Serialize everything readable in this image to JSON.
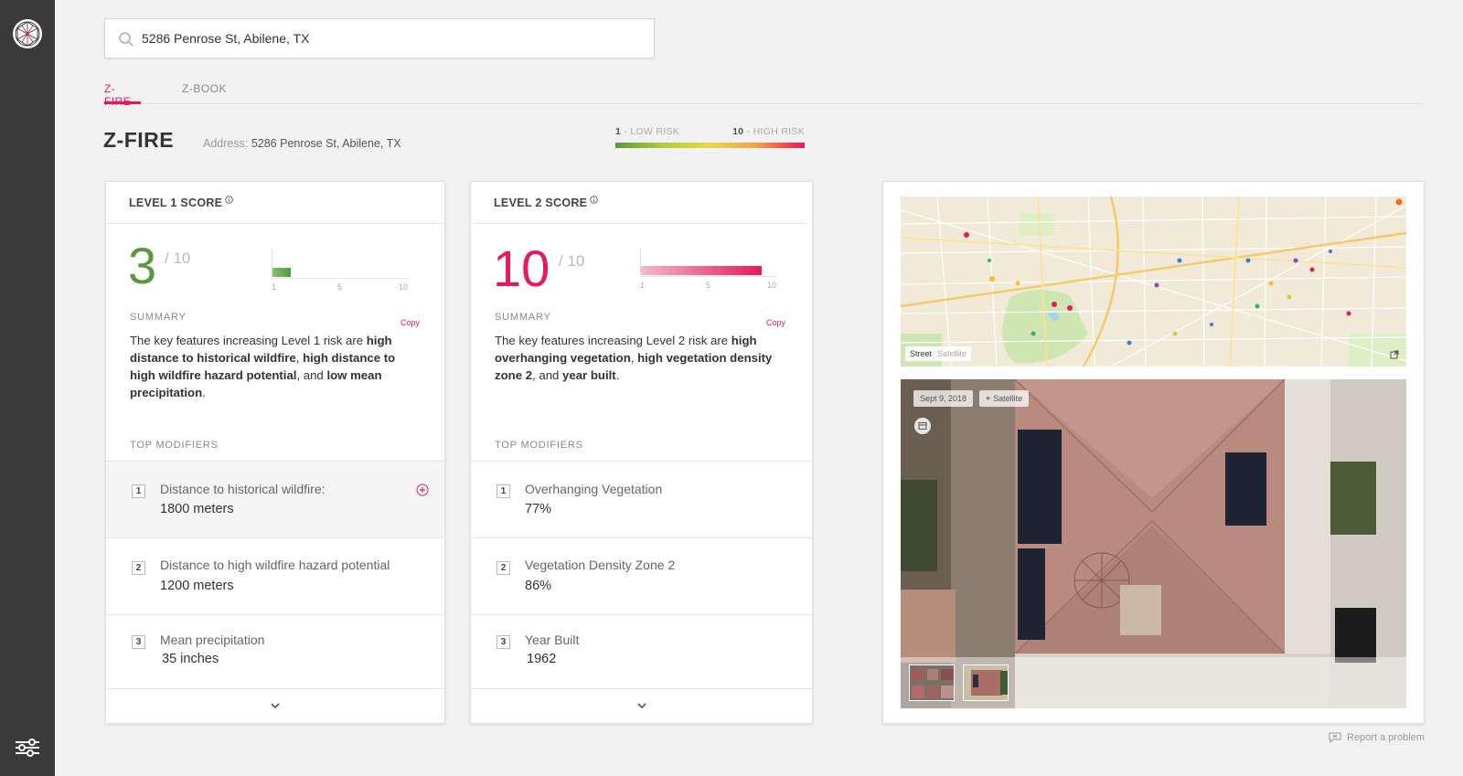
{
  "search": {
    "value": "5286 Penrose St, Abilene, TX"
  },
  "tabs": [
    {
      "label": "Z-FIRE",
      "active": true
    },
    {
      "label": "Z-BOOK",
      "active": false
    }
  ],
  "page": {
    "title": "Z-FIRE",
    "address_label": "Address:",
    "address_value": "5286 Penrose St, Abilene, TX"
  },
  "legend": {
    "low_num": "1",
    "low_text": "- LOW RISK",
    "high_num": "10",
    "high_text": "- HIGH RISK"
  },
  "level1": {
    "title": "LEVEL 1 SCORE",
    "score": "3",
    "score_fraction": 0.3,
    "max": "/ 10",
    "ticks": [
      "1",
      "5",
      "10"
    ],
    "summary_label": "SUMMARY",
    "copy_label": "Copy",
    "summary_parts": [
      "The key features increasing Level 1 risk are ",
      "high distance to historical wildfire",
      ", ",
      "high distance to high wildfire hazard potential",
      ", and ",
      "low mean precipitation",
      "."
    ],
    "modifiers_label": "TOP MODIFIERS",
    "modifiers": [
      {
        "num": "1",
        "label": "Distance to historical wildfire:",
        "value": "1800 meters"
      },
      {
        "num": "2",
        "label": "Distance to high wildfire hazard potential",
        "value": "1200 meters"
      },
      {
        "num": "3",
        "label": "Mean precipitation",
        "value": "35 inches"
      }
    ]
  },
  "level2": {
    "title": "LEVEL 2 SCORE",
    "score": "10",
    "score_fraction": 1.0,
    "max": "/ 10",
    "ticks": [
      "1",
      "5",
      "10"
    ],
    "summary_label": "SUMMARY",
    "copy_label": "Copy",
    "summary_parts": [
      "The key features increasing Level 2 risk are ",
      "high overhanging vegetation",
      ", ",
      "high vegetation density zone 2",
      ", and ",
      "year built",
      "."
    ],
    "modifiers_label": "TOP MODIFIERS",
    "modifiers": [
      {
        "num": "1",
        "label": "Overhanging Vegetation",
        "value": "77%"
      },
      {
        "num": "2",
        "label": "Vegetation Density Zone 2",
        "value": "86%"
      },
      {
        "num": "3",
        "label": "Year Built",
        "value": "1962"
      }
    ]
  },
  "map": {
    "street_label": "Street",
    "satellite_label": "Satellite"
  },
  "aerial": {
    "date": "Sept 9, 2018",
    "source": "Satellite"
  },
  "report": {
    "label": "Report a problem"
  },
  "colors": {
    "accent": "#e8195a",
    "low_risk": "#5a9a3c",
    "sidebar": "#3a3a3a"
  },
  "icons": [
    "logo-icon",
    "search-icon",
    "info-icon",
    "plus-circle-icon",
    "chevron-down-icon",
    "external-link-icon",
    "calendar-icon",
    "satellite-icon",
    "chat-icon",
    "filter-sliders-icon"
  ]
}
